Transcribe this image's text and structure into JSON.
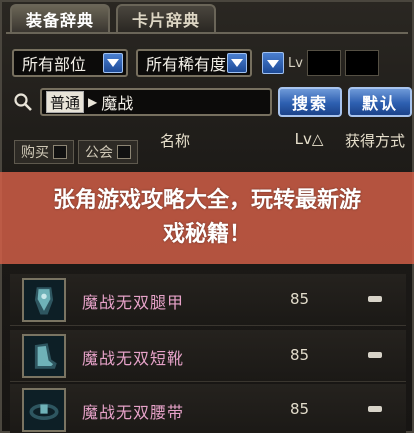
{
  "tabs": [
    {
      "label": "装备辞典",
      "active": true
    },
    {
      "label": "卡片辞典",
      "active": false
    }
  ],
  "filters": {
    "slot": "所有部位",
    "rarity": "所有稀有度",
    "lv_label": "Lv"
  },
  "search": {
    "mode": "普通",
    "value": "魔战",
    "search_button": "搜索",
    "default_button": "默认"
  },
  "subtabs": [
    {
      "label": "购买"
    },
    {
      "label": "公会"
    }
  ],
  "table": {
    "headers": {
      "name": "名称",
      "lv": "Lv△",
      "method": "获得方式"
    },
    "rows": [
      {
        "name": "魔战无双腿甲",
        "lv": "85",
        "method": "-"
      },
      {
        "name": "魔战无双短靴",
        "lv": "85",
        "method": "-"
      },
      {
        "name": "魔战无双腰带",
        "lv": "85",
        "method": "-"
      }
    ]
  },
  "banner": {
    "text": "张角游戏攻略大全，玩转最新游戏秘籍！"
  },
  "colors": {
    "item_name": "#e6a2c8",
    "button_blue": "#2d5fb0",
    "banner": "#d66048"
  }
}
